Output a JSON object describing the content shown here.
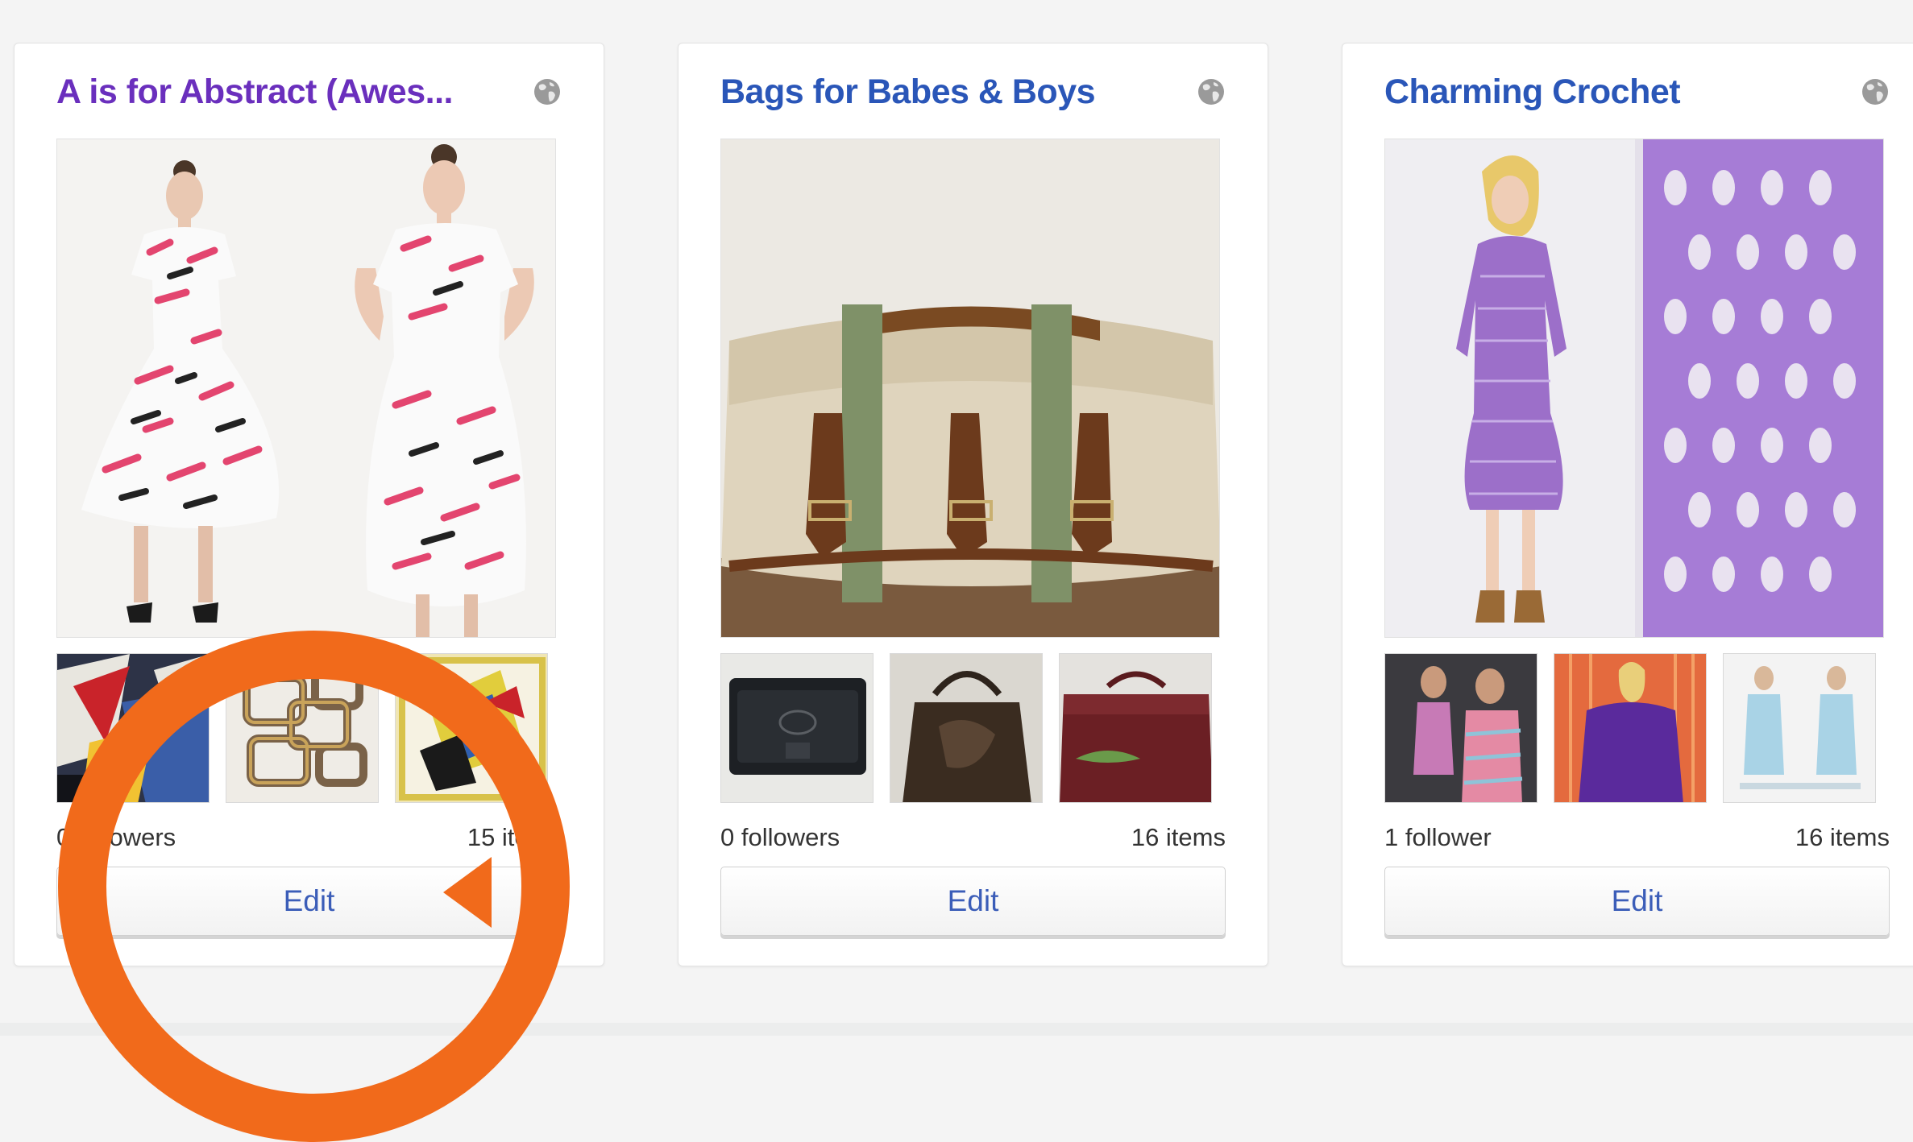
{
  "colors": {
    "visited_title": "#6a2fbd",
    "title": "#2a56b8",
    "edit_text": "#3b5db8",
    "highlight": "#f16a1b"
  },
  "collections": [
    {
      "title": "A is for Abstract (Awes...",
      "followers": "0 followers",
      "items": "15 items",
      "edit_label": "Edit",
      "visibility_icon": "globe-icon",
      "main_image": "two-models-pink-black-print-dress",
      "thumbnails": [
        "abstract-painting",
        "geometric-chain-artwork",
        "yellow-abstract-print"
      ]
    },
    {
      "title": "Bags for Babes & Boys",
      "followers": "0 followers",
      "items": "16 items",
      "edit_label": "Edit",
      "visibility_icon": "globe-icon",
      "main_image": "canvas-leather-messenger-bag",
      "thumbnails": [
        "black-leather-wallet",
        "brown-tooled-handbag",
        "burgundy-lacoste-bag"
      ]
    },
    {
      "title": "Charming Crochet",
      "followers": "1 follower",
      "items": "16 items",
      "edit_label": "Edit",
      "visibility_icon": "globe-icon",
      "main_image": "purple-crochet-dress",
      "thumbnails": [
        "pink-striped-dress-models",
        "purple-fringe-top",
        "light-blue-knit-dress"
      ]
    }
  ]
}
